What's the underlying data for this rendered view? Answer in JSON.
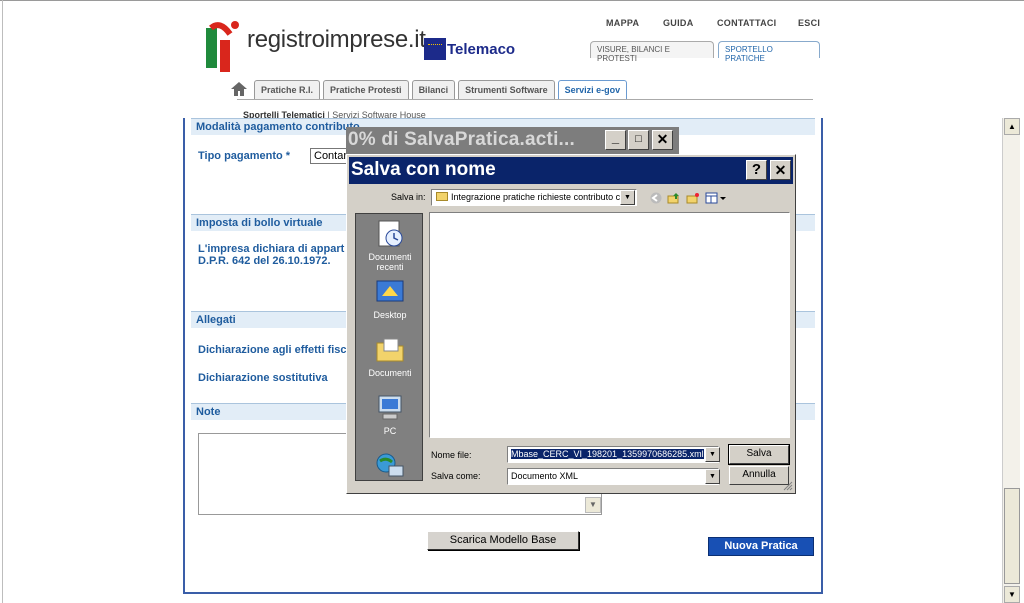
{
  "header": {
    "logo_text": "registroimprese.it",
    "telemaco": "Telemaco",
    "top_nav": [
      "MAPPA",
      "GUIDA",
      "CONTATTACI",
      "ESCI"
    ],
    "sub_tabs": [
      "VISURE, BILANCI E PROTESTI",
      "SPORTELLO PRATICHE"
    ],
    "main_tabs": [
      "Pratiche R.I.",
      "Pratiche Protesti",
      "Bilanci",
      "Strumenti Software",
      "Servizi e-gov"
    ],
    "breadcrumb_1": "Sportelli Telematici",
    "breadcrumb_sep": "|",
    "breadcrumb_2": "Servizi Software House"
  },
  "form": {
    "section_pagamento": "Modalità pagamento contributo",
    "tipo_pagamento_label": "Tipo pagamento *",
    "tipo_pagamento_value": "Contan",
    "section_bollo": "Imposta di bollo virtuale",
    "bollo_line1": "L'impresa dichiara di appart",
    "bollo_line2": "D.P.R. 642 del 26.10.1972.",
    "section_allegati": "Allegati",
    "allegato_1": "Dichiarazione agli effetti fisc",
    "allegato_2": "Dichiarazione sostitutiva",
    "section_note": "Note",
    "btn_scarica": "Scarica Modello Base",
    "btn_nuova": "Nuova Pratica"
  },
  "progress_window": {
    "title": "0% di SalvaPratica.acti..."
  },
  "save_dialog": {
    "title": "Salva con nome",
    "save_in_label": "Salva in:",
    "save_in_value": "Integrazione pratiche richieste contributo cor",
    "places": [
      "Documenti recenti",
      "Desktop",
      "Documenti",
      "PC",
      ""
    ],
    "filename_label": "Nome file:",
    "filename_value": "Mbase_CERC_VI_198201_1359970686285.xml",
    "savetype_label": "Salva come:",
    "savetype_value": "Documento XML",
    "btn_save": "Salva",
    "btn_cancel": "Annulla"
  }
}
